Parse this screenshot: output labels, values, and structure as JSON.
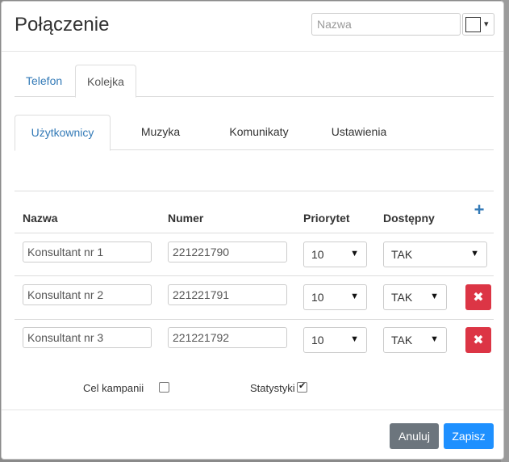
{
  "header": {
    "title": "Połączenie",
    "name_placeholder": "Nazwa",
    "color_caret": "▾"
  },
  "outer_tabs": [
    {
      "label": "Telefon",
      "active": false
    },
    {
      "label": "Kolejka",
      "active": true
    }
  ],
  "inner_tabs": [
    {
      "label": "Użytkownicy",
      "active": true
    },
    {
      "label": "Muzyka",
      "active": false
    },
    {
      "label": "Komunikaty",
      "active": false
    },
    {
      "label": "Ustawienia",
      "active": false
    }
  ],
  "table": {
    "headers": {
      "name": "Nazwa",
      "number": "Numer",
      "priority": "Priorytet",
      "available": "Dostępny"
    },
    "add_icon": "+",
    "rows": [
      {
        "name": "Konsultant nr 1",
        "number": "221221790",
        "priority": "10",
        "available": "TAK",
        "deletable": false
      },
      {
        "name": "Konsultant nr 2",
        "number": "221221791",
        "priority": "10",
        "available": "TAK",
        "deletable": true
      },
      {
        "name": "Konsultant nr 3",
        "number": "221221792",
        "priority": "10",
        "available": "TAK",
        "deletable": true
      }
    ],
    "caret": "▼",
    "delete_glyph": "✖"
  },
  "options": {
    "campaign_label": "Cel kampanii",
    "campaign_checked": false,
    "stats_label": "Statystyki",
    "stats_checked": true
  },
  "footer": {
    "cancel_label": "Anuluj",
    "save_label": "Zapisz"
  },
  "colors": {
    "link": "#337ab7",
    "danger": "#dc3545",
    "cancel": "#6c757d",
    "primary": "#1e90ff"
  }
}
